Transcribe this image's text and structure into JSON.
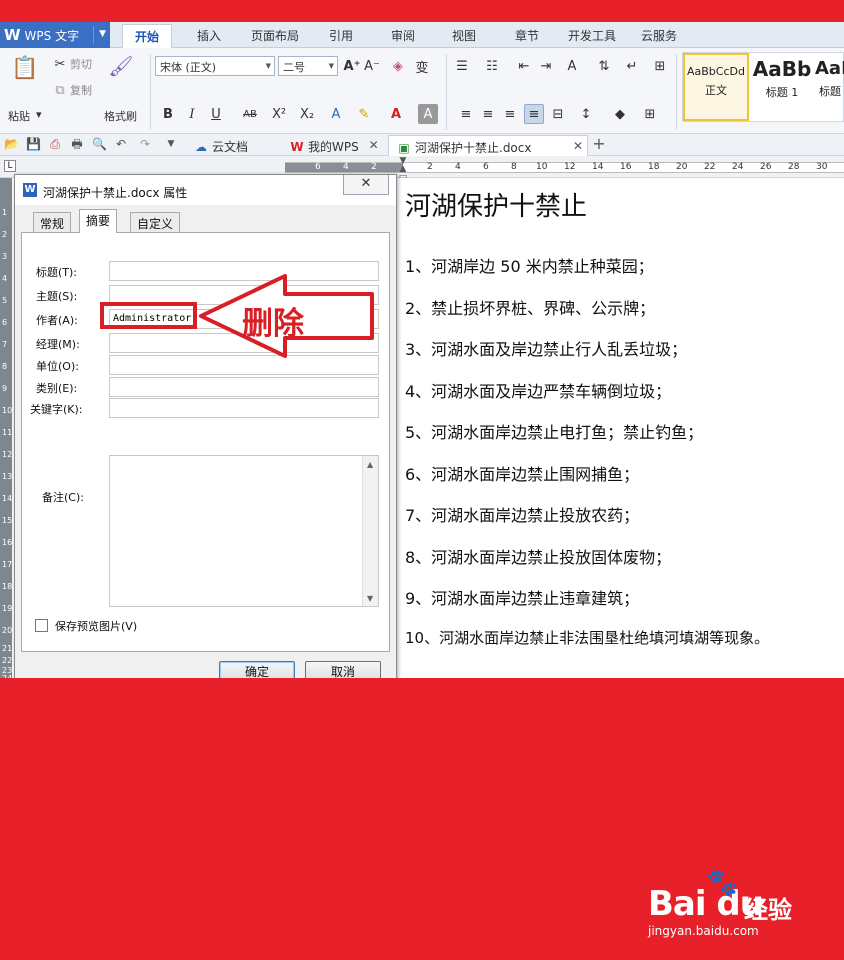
{
  "app": {
    "logo": "W",
    "title": "WPS 文字",
    "menu_tabs": [
      "开始",
      "插入",
      "页面布局",
      "引用",
      "审阅",
      "视图",
      "章节",
      "开发工具",
      "云服务"
    ]
  },
  "ribbon": {
    "paste": "粘贴",
    "cut": "剪切",
    "copy": "复制",
    "format_painter": "格式刷",
    "font_name": "宋体 (正文)",
    "font_size": "二号",
    "bold": "B",
    "italic": "I",
    "underline": "U",
    "strikethrough": "AB",
    "superscript": "X²",
    "subscript": "X₂",
    "styles": [
      {
        "sample": "AaBbCcDd",
        "name": "正文"
      },
      {
        "sample": "AaBb",
        "name": "标题 1"
      },
      {
        "sample": "AaE",
        "name": "标题"
      }
    ]
  },
  "doc_tabs": [
    {
      "label": "云文档",
      "active": false
    },
    {
      "label": "我的WPS",
      "active": false
    },
    {
      "label": "河湖保护十禁止.docx",
      "active": true
    }
  ],
  "ruler": {
    "corner": "L",
    "left_numbers": [
      "6",
      "4",
      "2"
    ],
    "right_numbers": [
      "2",
      "4",
      "6",
      "8",
      "10",
      "12",
      "14",
      "16",
      "18",
      "20",
      "22",
      "24",
      "26",
      "28",
      "30"
    ],
    "vertical_numbers": [
      "1",
      "2",
      "3",
      "4",
      "5",
      "6",
      "7",
      "8",
      "9",
      "10",
      "11",
      "12",
      "13",
      "14",
      "15",
      "16",
      "17",
      "18",
      "19",
      "20",
      "21",
      "22",
      "23",
      "24"
    ]
  },
  "dialog": {
    "title": "河湖保护十禁止.docx 属性",
    "close": "✕",
    "tabs": [
      "常规",
      "摘要",
      "自定义"
    ],
    "active_tab": "摘要",
    "fields": [
      {
        "label": "标题(T):",
        "value": ""
      },
      {
        "label": "主题(S):",
        "value": ""
      },
      {
        "label": "作者(A):",
        "value": "Administrator"
      },
      {
        "label": "经理(M):",
        "value": ""
      },
      {
        "label": "单位(O):",
        "value": ""
      },
      {
        "label": "类别(E):",
        "value": ""
      },
      {
        "label": "关键字(K):",
        "value": ""
      }
    ],
    "notes_label": "备注(C):",
    "notes_value": "",
    "preview_label": "保存预览图片(V)",
    "preview_checked": false,
    "ok": "确定",
    "cancel": "取消"
  },
  "annotation": {
    "text": "删除",
    "color": "#d81f26"
  },
  "document": {
    "title": "河湖保护十禁止",
    "lines": [
      "1、河湖岸边 50 米内禁止种菜园；",
      "2、禁止损坏界桩、界碑、公示牌；",
      "3、河湖水面及岸边禁止行人乱丢垃圾；",
      "4、河湖水面及岸边严禁车辆倒垃圾；",
      "5、河湖水面岸边禁止电打鱼；禁止钓鱼；",
      "6、河湖水面岸边禁止围网捕鱼；",
      "7、河湖水面岸边禁止投放农药；",
      "8、河湖水面岸边禁止投放固体废物；",
      "9、河湖水面岸边禁止违章建筑；",
      "10、河湖水面岸边禁止非法围垦杜绝填河填湖等现象。"
    ]
  },
  "watermark": {
    "logo_text": "Bai du",
    "brand": "经验",
    "url": "jingyan.baidu.com"
  },
  "colors": {
    "background": "#e8202a",
    "accent": "#3b6fc4",
    "annotation": "#d81f26"
  }
}
